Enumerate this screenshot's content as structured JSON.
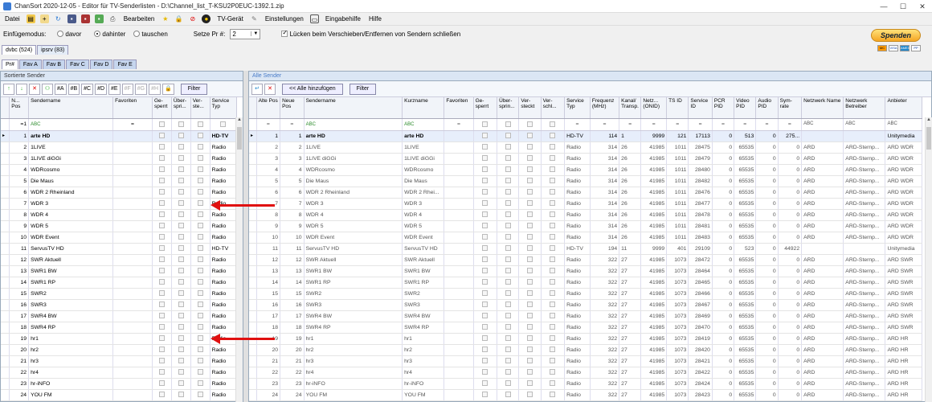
{
  "window": {
    "title": "ChanSort 2020-12-05 - Editor für TV-Senderlisten  - D:\\Channel_list_T-KSU2P0EUC-1392.1.zip",
    "minimize": "—",
    "maximize": "☐",
    "close": "✕"
  },
  "menu": {
    "file": "Datei",
    "edit": "Bearbeiten",
    "tv": "TV-Gerät",
    "settings": "Einstellungen",
    "input_help": "Eingabehilfe",
    "help": "Hilfe"
  },
  "options": {
    "insert_mode_label": "Einfügemodus:",
    "before": "davor",
    "after": "dahinter",
    "swap": "tauschen",
    "set_pr_label": "Setze Pr #:",
    "set_pr_value": "2",
    "close_gaps_label": "Lücken beim Verschieben/Entfernen von Sendern schließen"
  },
  "donate": {
    "label": "Spenden",
    "cards": [
      "MC",
      "VISA",
      "AMEX",
      "PP"
    ]
  },
  "source_tabs": [
    "dvbc (524)",
    "ipsrv (83)"
  ],
  "fav_tabs": [
    "Pr#",
    "Fav A",
    "Fav B",
    "Fav C",
    "Fav D",
    "Fav E"
  ],
  "left": {
    "header": "Sortierte Sender",
    "toolbar": [
      "↑",
      "↓",
      "✕",
      "⚇",
      "#A",
      "#B",
      "#C",
      "#D",
      "#E",
      "#F",
      "#G",
      "#H",
      "🔒"
    ],
    "filter": "Filter",
    "columns": [
      "N... Pos",
      "Sendername",
      "Favoriten",
      "Ge- sperrt",
      "Über- spri...",
      "Ver- ste...",
      "Service Typ"
    ],
    "filter_row": [
      "=1",
      "ABC"
    ]
  },
  "right": {
    "header": "Alle Sender",
    "add_all": "<< Alle hinzufügen",
    "filter": "Filter",
    "columns": [
      "Alte Pos",
      "Neue Pos",
      "Sendername",
      "Kurzname",
      "Favoriten",
      "Ge- sperrt",
      "Über- sprin...",
      "Ver- steckt",
      "Ver- schl...",
      "Service Typ",
      "Frequenz (MHz)",
      "Kanal/ Transp.",
      "Netz... (ONID)",
      "TS ID",
      "Service ID",
      "PCR PID",
      "Video PID",
      "Audio PID",
      "Sym- rate",
      "Netzwerk Name",
      "Netzwerk Betreiber",
      "Anbieter"
    ],
    "filter_row": [
      "=",
      "=",
      "ABC",
      "ABC"
    ]
  },
  "rows": [
    {
      "pos": "1",
      "name": "arte HD",
      "type": "HD-TV",
      "short": "arte HD",
      "freq": "114",
      "chan": "1",
      "onid": "9999",
      "ts": "121",
      "sid": "17113",
      "pcr": "0",
      "vpid": "513",
      "apid": "0",
      "sym": "275...",
      "nname": "",
      "nop": "",
      "prov": "Unitymedia"
    },
    {
      "pos": "2",
      "name": "1LIVE",
      "type": "Radio",
      "short": "1LIVE",
      "freq": "314",
      "chan": "26",
      "onid": "41985",
      "ts": "1011",
      "sid": "28475",
      "pcr": "0",
      "vpid": "65535",
      "apid": "0",
      "sym": "0",
      "nname": "ARD",
      "nop": "ARD-Sternp...",
      "prov": "ARD WDR"
    },
    {
      "pos": "3",
      "name": "1LIVE diGGi",
      "type": "Radio",
      "short": "1LIVE diGGi",
      "freq": "314",
      "chan": "26",
      "onid": "41985",
      "ts": "1011",
      "sid": "28479",
      "pcr": "0",
      "vpid": "65535",
      "apid": "0",
      "sym": "0",
      "nname": "ARD",
      "nop": "ARD-Sternp...",
      "prov": "ARD WDR"
    },
    {
      "pos": "4",
      "name": "WDRcosmo",
      "type": "Radio",
      "short": "WDRcosmo",
      "freq": "314",
      "chan": "26",
      "onid": "41985",
      "ts": "1011",
      "sid": "28480",
      "pcr": "0",
      "vpid": "65535",
      "apid": "0",
      "sym": "0",
      "nname": "ARD",
      "nop": "ARD-Sternp...",
      "prov": "ARD WDR"
    },
    {
      "pos": "5",
      "name": "Die Maus",
      "type": "Radio",
      "short": "Die Maus",
      "freq": "314",
      "chan": "26",
      "onid": "41985",
      "ts": "1011",
      "sid": "28482",
      "pcr": "0",
      "vpid": "65535",
      "apid": "0",
      "sym": "0",
      "nname": "ARD",
      "nop": "ARD-Sternp...",
      "prov": "ARD WDR"
    },
    {
      "pos": "6",
      "name": "WDR 2 Rheinland",
      "type": "Radio",
      "short": "WDR 2 Rhei...",
      "freq": "314",
      "chan": "26",
      "onid": "41985",
      "ts": "1011",
      "sid": "28476",
      "pcr": "0",
      "vpid": "65535",
      "apid": "0",
      "sym": "0",
      "nname": "ARD",
      "nop": "ARD-Sternp...",
      "prov": "ARD WDR"
    },
    {
      "pos": "7",
      "name": "WDR 3",
      "type": "Radio",
      "short": "WDR 3",
      "freq": "314",
      "chan": "26",
      "onid": "41985",
      "ts": "1011",
      "sid": "28477",
      "pcr": "0",
      "vpid": "65535",
      "apid": "0",
      "sym": "0",
      "nname": "ARD",
      "nop": "ARD-Sternp...",
      "prov": "ARD WDR"
    },
    {
      "pos": "8",
      "name": "WDR 4",
      "type": "Radio",
      "short": "WDR 4",
      "freq": "314",
      "chan": "26",
      "onid": "41985",
      "ts": "1011",
      "sid": "28478",
      "pcr": "0",
      "vpid": "65535",
      "apid": "0",
      "sym": "0",
      "nname": "ARD",
      "nop": "ARD-Sternp...",
      "prov": "ARD WDR"
    },
    {
      "pos": "9",
      "name": "WDR 5",
      "type": "Radio",
      "short": "WDR 5",
      "freq": "314",
      "chan": "26",
      "onid": "41985",
      "ts": "1011",
      "sid": "28481",
      "pcr": "0",
      "vpid": "65535",
      "apid": "0",
      "sym": "0",
      "nname": "ARD",
      "nop": "ARD-Sternp...",
      "prov": "ARD WDR"
    },
    {
      "pos": "10",
      "name": "WDR Event",
      "type": "Radio",
      "short": "WDR Event",
      "freq": "314",
      "chan": "26",
      "onid": "41985",
      "ts": "1011",
      "sid": "28483",
      "pcr": "0",
      "vpid": "65535",
      "apid": "0",
      "sym": "0",
      "nname": "ARD",
      "nop": "ARD-Sternp...",
      "prov": "ARD WDR"
    },
    {
      "pos": "11",
      "name": "ServusTV HD",
      "type": "HD-TV",
      "short": "ServusTV HD",
      "freq": "194",
      "chan": "11",
      "onid": "9999",
      "ts": "401",
      "sid": "29109",
      "pcr": "0",
      "vpid": "523",
      "apid": "0",
      "sym": "44922",
      "nname": "",
      "nop": "",
      "prov": "Unitymedia"
    },
    {
      "pos": "12",
      "name": "SWR Aktuell",
      "type": "Radio",
      "short": "SWR Aktuell",
      "freq": "322",
      "chan": "27",
      "onid": "41985",
      "ts": "1073",
      "sid": "28472",
      "pcr": "0",
      "vpid": "65535",
      "apid": "0",
      "sym": "0",
      "nname": "ARD",
      "nop": "ARD-Sternp...",
      "prov": "ARD SWR"
    },
    {
      "pos": "13",
      "name": "SWR1 BW",
      "type": "Radio",
      "short": "SWR1 BW",
      "freq": "322",
      "chan": "27",
      "onid": "41985",
      "ts": "1073",
      "sid": "28464",
      "pcr": "0",
      "vpid": "65535",
      "apid": "0",
      "sym": "0",
      "nname": "ARD",
      "nop": "ARD-Sternp...",
      "prov": "ARD SWR"
    },
    {
      "pos": "14",
      "name": "SWR1 RP",
      "type": "Radio",
      "short": "SWR1 RP",
      "freq": "322",
      "chan": "27",
      "onid": "41985",
      "ts": "1073",
      "sid": "28465",
      "pcr": "0",
      "vpid": "65535",
      "apid": "0",
      "sym": "0",
      "nname": "ARD",
      "nop": "ARD-Sternp...",
      "prov": "ARD SWR"
    },
    {
      "pos": "15",
      "name": "SWR2",
      "type": "Radio",
      "short": "SWR2",
      "freq": "322",
      "chan": "27",
      "onid": "41985",
      "ts": "1073",
      "sid": "28466",
      "pcr": "0",
      "vpid": "65535",
      "apid": "0",
      "sym": "0",
      "nname": "ARD",
      "nop": "ARD-Sternp...",
      "prov": "ARD SWR"
    },
    {
      "pos": "16",
      "name": "SWR3",
      "type": "Radio",
      "short": "SWR3",
      "freq": "322",
      "chan": "27",
      "onid": "41985",
      "ts": "1073",
      "sid": "28467",
      "pcr": "0",
      "vpid": "65535",
      "apid": "0",
      "sym": "0",
      "nname": "ARD",
      "nop": "ARD-Sternp...",
      "prov": "ARD SWR"
    },
    {
      "pos": "17",
      "name": "SWR4 BW",
      "type": "Radio",
      "short": "SWR4 BW",
      "freq": "322",
      "chan": "27",
      "onid": "41985",
      "ts": "1073",
      "sid": "28469",
      "pcr": "0",
      "vpid": "65535",
      "apid": "0",
      "sym": "0",
      "nname": "ARD",
      "nop": "ARD-Sternp...",
      "prov": "ARD SWR"
    },
    {
      "pos": "18",
      "name": "SWR4 RP",
      "type": "Radio",
      "short": "SWR4 RP",
      "freq": "322",
      "chan": "27",
      "onid": "41985",
      "ts": "1073",
      "sid": "28470",
      "pcr": "0",
      "vpid": "65535",
      "apid": "0",
      "sym": "0",
      "nname": "ARD",
      "nop": "ARD-Sternp...",
      "prov": "ARD SWR"
    },
    {
      "pos": "19",
      "name": "hr1",
      "type": "Radio",
      "short": "hr1",
      "freq": "322",
      "chan": "27",
      "onid": "41985",
      "ts": "1073",
      "sid": "28419",
      "pcr": "0",
      "vpid": "65535",
      "apid": "0",
      "sym": "0",
      "nname": "ARD",
      "nop": "ARD-Sternp...",
      "prov": "ARD HR"
    },
    {
      "pos": "20",
      "name": "hr2",
      "type": "Radio",
      "short": "hr2",
      "freq": "322",
      "chan": "27",
      "onid": "41985",
      "ts": "1073",
      "sid": "28420",
      "pcr": "0",
      "vpid": "65535",
      "apid": "0",
      "sym": "0",
      "nname": "ARD",
      "nop": "ARD-Sternp...",
      "prov": "ARD HR"
    },
    {
      "pos": "21",
      "name": "hr3",
      "type": "Radio",
      "short": "hr3",
      "freq": "322",
      "chan": "27",
      "onid": "41985",
      "ts": "1073",
      "sid": "28421",
      "pcr": "0",
      "vpid": "65535",
      "apid": "0",
      "sym": "0",
      "nname": "ARD",
      "nop": "ARD-Sternp...",
      "prov": "ARD HR"
    },
    {
      "pos": "22",
      "name": "hr4",
      "type": "Radio",
      "short": "hr4",
      "freq": "322",
      "chan": "27",
      "onid": "41985",
      "ts": "1073",
      "sid": "28422",
      "pcr": "0",
      "vpid": "65535",
      "apid": "0",
      "sym": "0",
      "nname": "ARD",
      "nop": "ARD-Sternp...",
      "prov": "ARD HR"
    },
    {
      "pos": "23",
      "name": "hr-iNFO",
      "type": "Radio",
      "short": "hr-iNFO",
      "freq": "322",
      "chan": "27",
      "onid": "41985",
      "ts": "1073",
      "sid": "28424",
      "pcr": "0",
      "vpid": "65535",
      "apid": "0",
      "sym": "0",
      "nname": "ARD",
      "nop": "ARD-Sternp...",
      "prov": "ARD HR"
    },
    {
      "pos": "24",
      "name": "YOU FM",
      "type": "Radio",
      "short": "YOU FM",
      "freq": "322",
      "chan": "27",
      "onid": "41985",
      "ts": "1073",
      "sid": "28423",
      "pcr": "0",
      "vpid": "65535",
      "apid": "0",
      "sym": "0",
      "nname": "ARD",
      "nop": "ARD-Sternp...",
      "prov": "ARD HR"
    }
  ],
  "colors": {
    "annotation_arrow": "#e01010",
    "selected_row": "#e7eefb",
    "panel_header": "#dbe6f4"
  }
}
